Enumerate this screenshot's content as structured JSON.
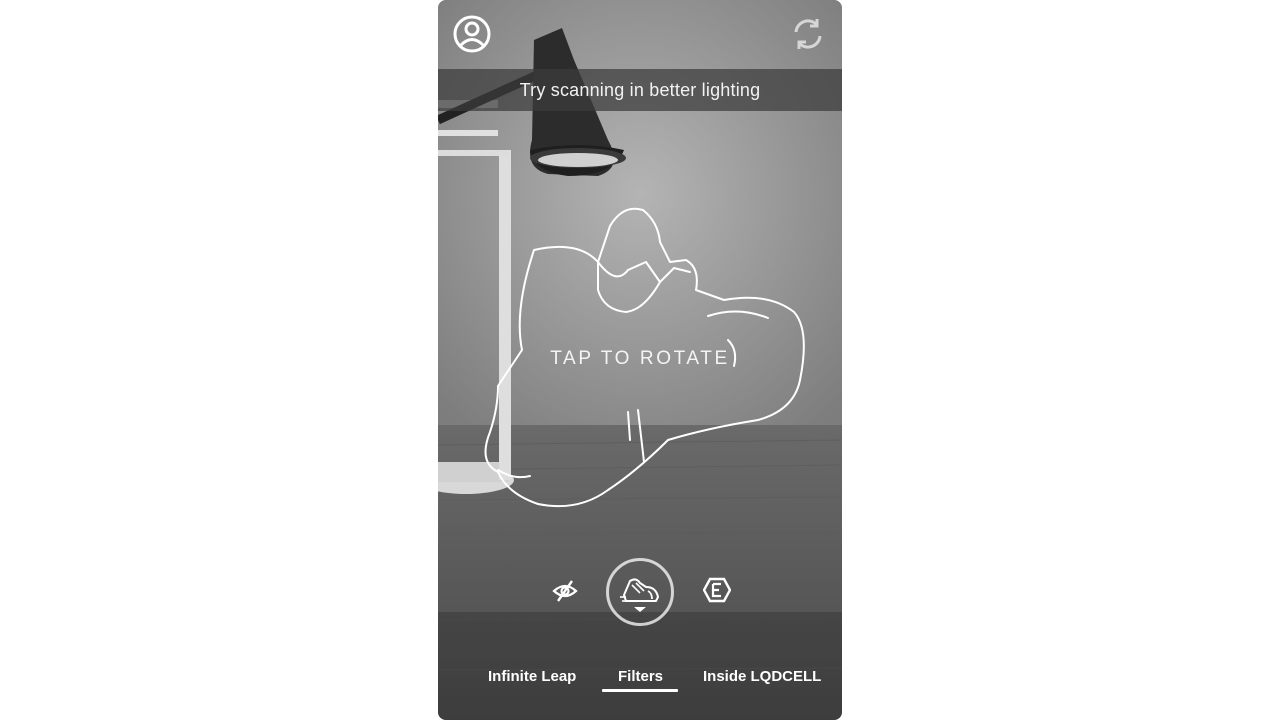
{
  "banner": {
    "text": "Try scanning in better lighting"
  },
  "canvas": {
    "hint": "TAP TO ROTATE"
  },
  "icons": {
    "profile": "user-circle-icon",
    "refresh": "refresh-icon",
    "visibility": "eye-off-icon",
    "scan_mode": "shoe-scan-icon",
    "expand": "chevron-down-icon",
    "badge": "hexagon-e-icon"
  },
  "tabs": [
    {
      "label": "Infinite Leap"
    },
    {
      "label": "Filters",
      "active": true
    },
    {
      "label": "Inside LQDCELL"
    }
  ],
  "colors": {
    "background": "#8a8a8a",
    "banner": "#3c3c3c",
    "text": "#ffffff"
  }
}
